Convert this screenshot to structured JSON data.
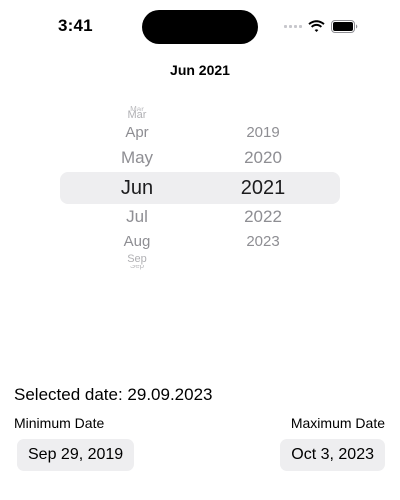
{
  "status_bar": {
    "time": "3:41"
  },
  "header": {
    "title": "Jun 2021"
  },
  "picker": {
    "months": [
      "Mar",
      "Mar",
      "Apr",
      "May",
      "Jun",
      "Jul",
      "Aug",
      "Sep",
      "Sep"
    ],
    "years": [
      "2019",
      "2020",
      "2021",
      "2022",
      "2023"
    ],
    "selected_month": "Jun",
    "selected_year": "2021"
  },
  "info": {
    "selected_date": "Selected date: 29.09.2023",
    "min_label": "Minimum Date",
    "max_label": "Maximum Date",
    "min_value": "Sep 29, 2019",
    "max_value": "Oct 3, 2023"
  },
  "icons": {
    "signal": "cellular-signal-icon",
    "wifi": "wifi-icon",
    "battery": "battery-icon"
  }
}
